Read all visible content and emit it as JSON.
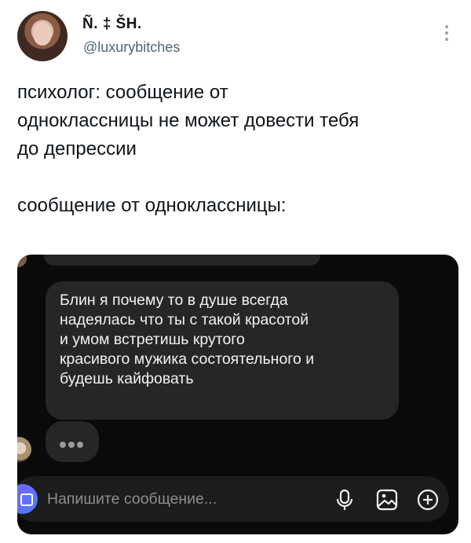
{
  "tweet": {
    "display_name": "Ñ. ‡ ŠH.",
    "handle": "@luxurybitches",
    "lines": [
      "психолог: сообщение от",
      "одноклассницы не может довести тебя",
      "до депрессии",
      "",
      "сообщение от одноклассницы:"
    ]
  },
  "chat": {
    "message_lines": [
      "Блин я почему то в душе всегда",
      "надеялась что ты с такой красотой",
      "и умом встретишь крутого",
      "красивого мужика состоятельного и",
      "будешь кайфовать"
    ],
    "composer_placeholder": "Напишите сообщение...",
    "icons": [
      "camera-icon",
      "mic-icon",
      "image-icon",
      "plus-icon"
    ]
  },
  "colors": {
    "background": "#ffffff",
    "chat_background": "#0a0a0a",
    "bubble": "#262626",
    "handle_text": "#536471"
  }
}
